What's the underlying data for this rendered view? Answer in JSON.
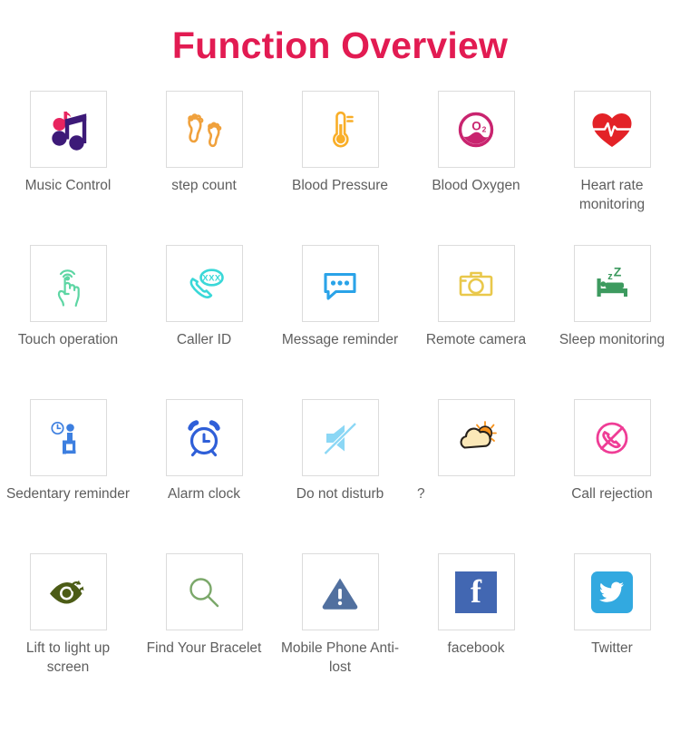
{
  "header": {
    "title": "Function Overview",
    "title_color": "#e21b52"
  },
  "theme": {
    "background": "#ffffff",
    "tile_border": "#dcdcdc",
    "label_color": "#5e5e5e"
  },
  "grid": {
    "columns": 5,
    "rows": 4,
    "items": [
      {
        "label": "Music Control",
        "icon": "music-note-icon",
        "color": "#3d1a78",
        "accent": "#e8245f",
        "align": "center"
      },
      {
        "label": "step count",
        "icon": "footprints-icon",
        "color": "#f0a13c",
        "accent": "#f0a13c",
        "align": "center"
      },
      {
        "label": "Blood Pressure",
        "icon": "thermometer-icon",
        "color": "#f9ae28",
        "accent": "#f9ae28",
        "align": "center"
      },
      {
        "label": "Blood Oxygen",
        "icon": "blood-oxygen-icon",
        "color": "#c9246f",
        "accent": "#c9246f",
        "align": "center"
      },
      {
        "label": "Heart rate monitoring",
        "icon": "heart-pulse-icon",
        "color": "#e32227",
        "accent": "#ffffff",
        "align": "center"
      },
      {
        "label": "Touch operation",
        "icon": "touch-hand-icon",
        "color": "#5ed6a4",
        "accent": "#5ed6a4",
        "align": "center"
      },
      {
        "label": "Caller ID",
        "icon": "caller-id-phone-icon",
        "color": "#3ad8d8",
        "accent": "#3ad8d8",
        "align": "center"
      },
      {
        "label": "Message reminder",
        "icon": "speech-bubble-icon",
        "color": "#2aa3e8",
        "accent": "#2aa3e8",
        "align": "center"
      },
      {
        "label": "Remote camera",
        "icon": "camera-icon",
        "color": "#e9c84b",
        "accent": "#e9c84b",
        "align": "center"
      },
      {
        "label": "Sleep monitoring",
        "icon": "sleeping-bed-icon",
        "color": "#3d9a5f",
        "accent": "#3d9a5f",
        "align": "center"
      },
      {
        "label": "Sedentary reminder",
        "icon": "sedentary-person-icon",
        "color": "#3d7fe0",
        "accent": "#3d7fe0",
        "align": "center"
      },
      {
        "label": "Alarm clock",
        "icon": "alarm-clock-icon",
        "color": "#2f5fd8",
        "accent": "#2f5fd8",
        "align": "center"
      },
      {
        "label": "Do not disturb",
        "icon": "mute-speaker-icon",
        "color": "#8bd7f5",
        "accent": "#8bd7f5",
        "align": "center"
      },
      {
        "label": "?",
        "icon": "weather-sun-cloud-icon",
        "color": "#f7931e",
        "accent": "#fbe8b8",
        "align": "left"
      },
      {
        "label": "Call rejection",
        "icon": "call-reject-icon",
        "color": "#ef3d96",
        "accent": "#ef3d96",
        "align": "center"
      },
      {
        "label": "Lift to light up screen",
        "icon": "eye-refresh-icon",
        "color": "#4c5c16",
        "accent": "#4c5c16",
        "align": "center"
      },
      {
        "label": "Find Your Bracelet",
        "icon": "magnifier-icon",
        "color": "#7ba86a",
        "accent": "#7ba86a",
        "align": "center"
      },
      {
        "label": "Mobile Phone Anti-lost",
        "icon": "warning-triangle-icon",
        "color": "#51709f",
        "accent": "#ffffff",
        "align": "center"
      },
      {
        "label": "facebook",
        "icon": "facebook-icon",
        "color": "#4267b2",
        "accent": "#ffffff",
        "align": "center"
      },
      {
        "label": "Twitter",
        "icon": "twitter-icon",
        "color": "#32a9e0",
        "accent": "#ffffff",
        "align": "center"
      }
    ]
  }
}
